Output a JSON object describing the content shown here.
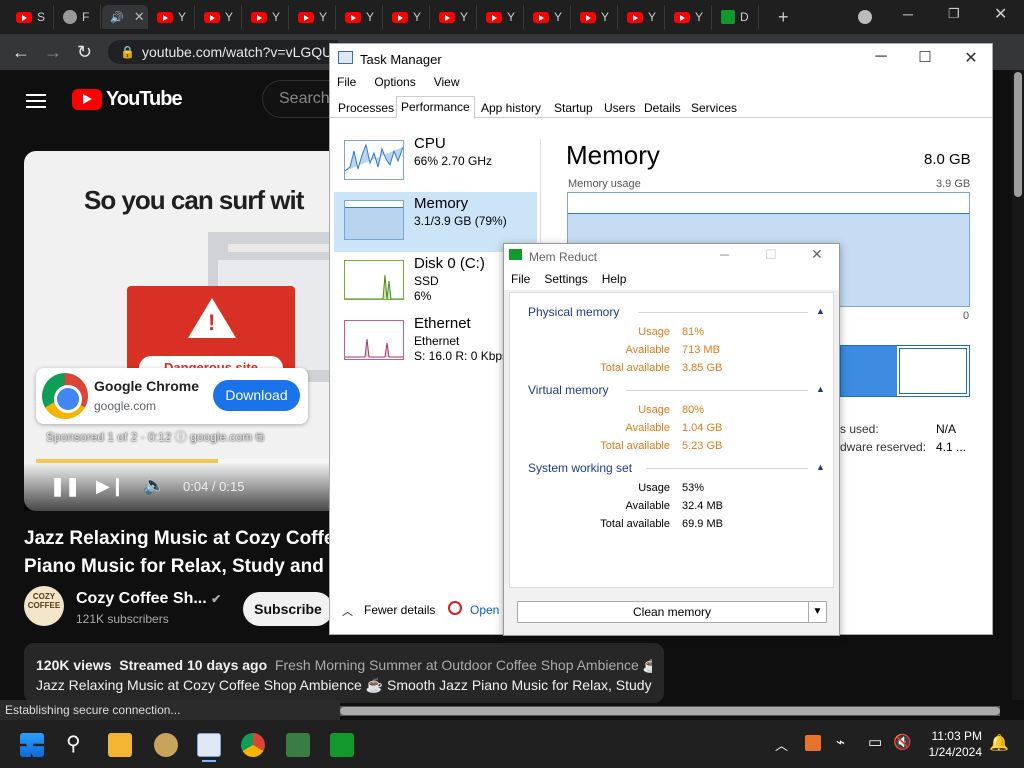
{
  "browser": {
    "tabs": [
      {
        "label": "S"
      },
      {
        "label": "F"
      },
      {
        "label": ""
      },
      {
        "label": "Y"
      },
      {
        "label": "Y"
      },
      {
        "label": "Y"
      },
      {
        "label": "Y"
      },
      {
        "label": "Y"
      },
      {
        "label": "Y"
      },
      {
        "label": "Y"
      },
      {
        "label": "Y"
      },
      {
        "label": "Y"
      },
      {
        "label": "Y"
      },
      {
        "label": "Y"
      },
      {
        "label": "Y"
      },
      {
        "label": "D"
      }
    ],
    "url": "youtube.com/watch?v=vLGQU",
    "status": "Establishing secure connection..."
  },
  "youtube": {
    "logo": "YouTube",
    "search_placeholder": "Search",
    "ad": {
      "headline": "So you can surf wit",
      "warning_text": "Dangerous site",
      "advertiser": "Google Chrome",
      "domain": "google.com",
      "cta": "Download",
      "sponsored": "Sponsored 1 of 2 · 0:12  ⓘ  google.com ⧉"
    },
    "player": {
      "time": "0:04 / 0:15",
      "progress": 0.61
    },
    "video": {
      "title_line1": "Jazz Relaxing Music at Cozy Coffe",
      "title_line2": "Piano Music for Relax, Study and W",
      "channel": "Cozy Coffee Sh...",
      "channel_avatar_text": "COZY COFFEE",
      "subscribers": "121K subscribers",
      "subscribe": "Subscribe",
      "views": "120K views",
      "streamed": "Streamed 10 days ago",
      "tags": "Fresh Morning Summer at Outdoor Coffee Shop Ambience ☕",
      "desc_line2": "Jazz Relaxing Music at Cozy Coffee Shop Ambience ☕ Smooth Jazz Piano Music for Relax, Study"
    }
  },
  "task_manager": {
    "title": "Task Manager",
    "menu": [
      "File",
      "Options",
      "View"
    ],
    "tabs": [
      "Processes",
      "Performance",
      "App history",
      "Startup",
      "Users",
      "Details",
      "Services"
    ],
    "selected_tab": "Performance",
    "items": [
      {
        "name": "CPU",
        "line1": "66%  2.70 GHz",
        "line2": ""
      },
      {
        "name": "Memory",
        "line1": "3.1/3.9 GB (79%)",
        "line2": ""
      },
      {
        "name": "Disk 0 (C:)",
        "line1": "SSD",
        "line2": "6%"
      },
      {
        "name": "Ethernet",
        "line1": "Ethernet",
        "line2": "S: 16.0  R: 0 Kbps"
      }
    ],
    "detail": {
      "title": "Memory",
      "total": "8.0 GB",
      "usage_label": "Memory usage",
      "usage_max": "3.9 GB",
      "zero": "0",
      "paged_label": "s used:",
      "paged_value": "N/A",
      "hw_label": "dware reserved:",
      "hw_value": "4.1 ..."
    },
    "footer": {
      "fewer": "Fewer details",
      "open": "Open"
    }
  },
  "mem_reduct": {
    "title": "Mem Reduct",
    "menu": [
      "File",
      "Settings",
      "Help"
    ],
    "groups": [
      {
        "name": "Physical memory",
        "rows": [
          {
            "label": "Usage",
            "value": "81%"
          },
          {
            "label": "Available",
            "value": "713 MB"
          },
          {
            "label": "Total available",
            "value": "3.85 GB"
          }
        ]
      },
      {
        "name": "Virtual memory",
        "rows": [
          {
            "label": "Usage",
            "value": "80%"
          },
          {
            "label": "Available",
            "value": "1.04 GB"
          },
          {
            "label": "Total available",
            "value": "5.23 GB"
          }
        ]
      },
      {
        "name": "System working set",
        "rows": [
          {
            "label": "Usage",
            "value": "53%"
          },
          {
            "label": "Available",
            "value": "32.4 MB"
          },
          {
            "label": "Total available",
            "value": "69.9 MB"
          }
        ]
      }
    ],
    "clean_button": "Clean memory"
  },
  "taskbar": {
    "time": "11:03 PM",
    "date": "1/24/2024"
  },
  "colors": {
    "accent": "#1a73e8",
    "youtube_red": "#ff0000",
    "mem_orange": "#e07b1a",
    "mem_blue": "#1c3a8c"
  }
}
